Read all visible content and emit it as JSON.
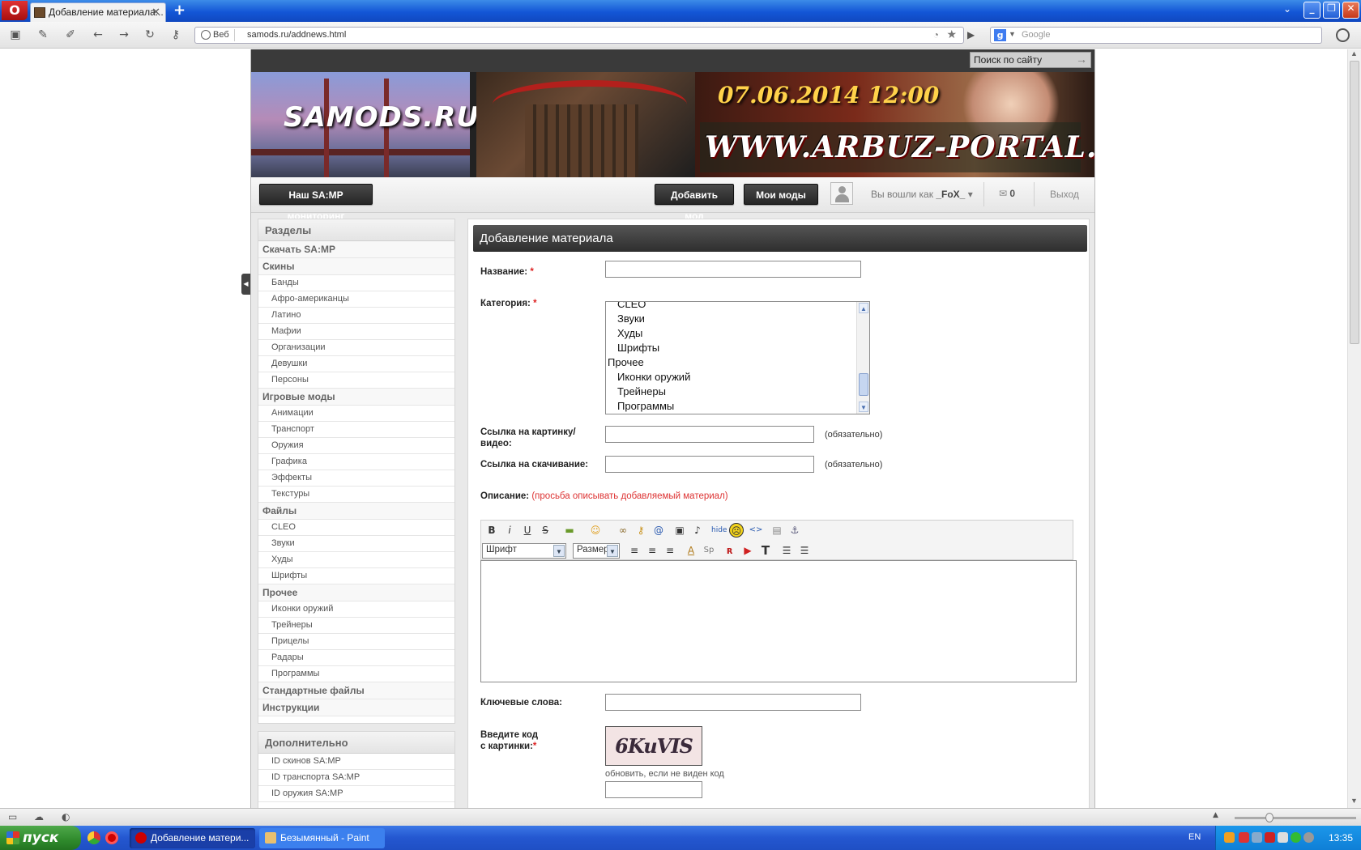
{
  "browser": {
    "tab_title": "Добавление материала...",
    "tab_close": "✕",
    "new_tab": "+",
    "address_security": "Веб",
    "url": "samods.ru/addnews.html",
    "search_engine_letter": "g",
    "search_placeholder": "Google",
    "window_buttons": {
      "minimize": "_",
      "maximize": "❐",
      "close": "✕"
    }
  },
  "site": {
    "search_label": "Поиск по сайту",
    "banner": {
      "logo_text": "SAMODS.RU",
      "date_text": "07.06.2014 12:00",
      "portal_text": "WWW.ARBUZ-PORTAL.NET"
    },
    "userbar": {
      "monitoring_button": "Наш SA:MP мониторинг",
      "add_mod_button": "Добавить мод",
      "my_mods_button": "Мои моды",
      "logged_in_prefix": "Вы вошли как",
      "username": "_FoX_",
      "messages_count": "0",
      "logout": "Выход"
    },
    "sidebar": {
      "title": "Разделы",
      "items": [
        {
          "label": "Скачать SA:MP",
          "type": "cat"
        },
        {
          "label": "Скины",
          "type": "cat"
        },
        {
          "label": "Банды",
          "type": "sub"
        },
        {
          "label": "Афро-американцы",
          "type": "sub"
        },
        {
          "label": "Латино",
          "type": "sub"
        },
        {
          "label": "Мафии",
          "type": "sub"
        },
        {
          "label": "Организации",
          "type": "sub"
        },
        {
          "label": "Девушки",
          "type": "sub"
        },
        {
          "label": "Персоны",
          "type": "sub"
        },
        {
          "label": "Игровые моды",
          "type": "cat"
        },
        {
          "label": "Анимации",
          "type": "sub"
        },
        {
          "label": "Транспорт",
          "type": "sub"
        },
        {
          "label": "Оружия",
          "type": "sub"
        },
        {
          "label": "Графика",
          "type": "sub"
        },
        {
          "label": "Эффекты",
          "type": "sub"
        },
        {
          "label": "Текстуры",
          "type": "sub"
        },
        {
          "label": "Файлы",
          "type": "cat"
        },
        {
          "label": "CLEO",
          "type": "sub"
        },
        {
          "label": "Звуки",
          "type": "sub"
        },
        {
          "label": "Худы",
          "type": "sub"
        },
        {
          "label": "Шрифты",
          "type": "sub"
        },
        {
          "label": "Прочее",
          "type": "cat"
        },
        {
          "label": "Иконки оружий",
          "type": "sub"
        },
        {
          "label": "Трейнеры",
          "type": "sub"
        },
        {
          "label": "Прицелы",
          "type": "sub"
        },
        {
          "label": "Радары",
          "type": "sub"
        },
        {
          "label": "Программы",
          "type": "sub"
        },
        {
          "label": "Стандартные файлы",
          "type": "cat"
        },
        {
          "label": "Инструкции",
          "type": "cat"
        }
      ]
    },
    "sidebar2": {
      "title": "Дополнительно",
      "items": [
        "ID скинов SA:MP",
        "ID транспорта SA:MP",
        "ID оружия SA:MP"
      ]
    },
    "form": {
      "title": "Добавление материала",
      "name_label": "Название:",
      "category_label": "Категория:",
      "category_options": [
        {
          "label": "CLEO",
          "level": 1
        },
        {
          "label": "Звуки",
          "level": 1
        },
        {
          "label": "Худы",
          "level": 1
        },
        {
          "label": "Шрифты",
          "level": 1
        },
        {
          "label": "Прочее",
          "level": 0
        },
        {
          "label": "Иконки оружий",
          "level": 1
        },
        {
          "label": "Трейнеры",
          "level": 1
        },
        {
          "label": "Программы",
          "level": 1
        }
      ],
      "image_link_label_1": "Ссылка на картинку/",
      "image_link_label_2": "видео:",
      "download_link_label": "Ссылка на скачивание:",
      "required_note": "(обязательно)",
      "description_label": "Описание:",
      "description_note": "(просьба описывать добавляемый материал)",
      "font_select": "Шрифт",
      "size_select": "Размер",
      "keywords_label": "Ключевые слова:",
      "captcha_label_1": "Введите код",
      "captcha_label_2": "с картинки:",
      "captcha_text": "6KuVIS",
      "captcha_refresh": "обновить, если не виден код"
    }
  },
  "taskbar": {
    "start": "пуск",
    "tasks": [
      "Добавление матери...",
      "Безымянный - Paint"
    ],
    "lang": "EN",
    "time": "13:35"
  }
}
